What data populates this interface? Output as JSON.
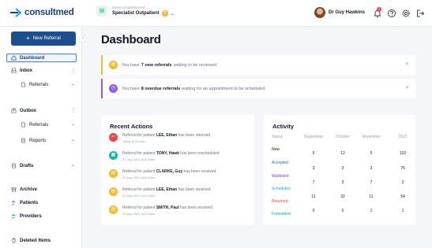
{
  "header": {
    "logo_text": "consultmed",
    "establishment_label": "Select establishment",
    "establishment_value": "Specialist Outpatient",
    "establishment_count": "3",
    "user_name": "Dr Guy Hawkins",
    "notification_count": "1"
  },
  "sidebar": {
    "new_referral": "New Referral",
    "dashboard": "Dashboard",
    "inbox": "Inbox",
    "inbox_referrals": "Referrals",
    "outbox": "Outbox",
    "outbox_referrals": "Referrals",
    "outbox_reports": "Reports",
    "drafts": "Drafts",
    "archive": "Archive",
    "patients": "Patients",
    "providers": "Providers",
    "deleted_items": "Deleted Items"
  },
  "main": {
    "title": "Dashboard",
    "alerts": [
      {
        "prefix": "You have",
        "bold": "7 new referrals",
        "suffix": "waiting to be reviewed",
        "color": "#f5b92e"
      },
      {
        "prefix": "You have",
        "bold": "8 overdue referrals",
        "suffix": "waiting for an appointment to be scheduled.",
        "color": "#8b5cf6"
      }
    ],
    "recent_actions": {
      "title": "Recent Actions",
      "items": [
        {
          "pre": "Referral for patient",
          "patient": "LEE, Ethan",
          "post": "has been returned",
          "time": "Today at 8:10am",
          "color": "#ef4444",
          "icon": "return-icon"
        },
        {
          "pre": "Referral for patient",
          "patient": "TONY, Hawk",
          "post": "has been rescheduled",
          "time": "27 Aug 2021 at 8:10am",
          "color": "#14b8a6",
          "icon": "calendar-icon"
        },
        {
          "pre": "Referral for patient",
          "patient": "CLARKE, Guy",
          "post": "has been received",
          "time": "22 Aug 2021 at 8:10am",
          "color": "#f5b92e",
          "icon": "document-icon"
        },
        {
          "pre": "Referral for patient",
          "patient": "LEE, Ethan",
          "post": "has been received",
          "time": "22 Aug 2021 at 8:10am",
          "color": "#f5b92e",
          "icon": "document-icon"
        },
        {
          "pre": "Referral for patient",
          "patient": "SMITH, Paul",
          "post": "has been received",
          "time": "22 Aug 2021 at 8:10am",
          "color": "#f5b92e",
          "icon": "document-icon"
        }
      ]
    },
    "activity": {
      "title": "Activity",
      "columns": [
        "Status",
        "September",
        "October",
        "November",
        "2022"
      ],
      "rows": [
        {
          "status": "New",
          "color": "#111827",
          "values": [
            "5",
            "12",
            "5",
            "102"
          ]
        },
        {
          "status": "Accepted",
          "color": "#2563eb",
          "values": [
            "3",
            "3",
            "3",
            "76"
          ]
        },
        {
          "status": "Waitlisted",
          "color": "#7c3aed",
          "values": [
            "7",
            "3",
            "7",
            "2"
          ]
        },
        {
          "status": "Scheduled",
          "color": "#14b8a6",
          "values": [
            "11",
            "32",
            "11",
            "54"
          ]
        },
        {
          "status": "Returned",
          "color": "#ef4444",
          "values": [
            "0",
            "0",
            "1",
            "1"
          ]
        },
        {
          "status": "Forwarded",
          "color": "#0ea5e9",
          "values": [
            "",
            "",
            "",
            ""
          ]
        }
      ]
    }
  }
}
